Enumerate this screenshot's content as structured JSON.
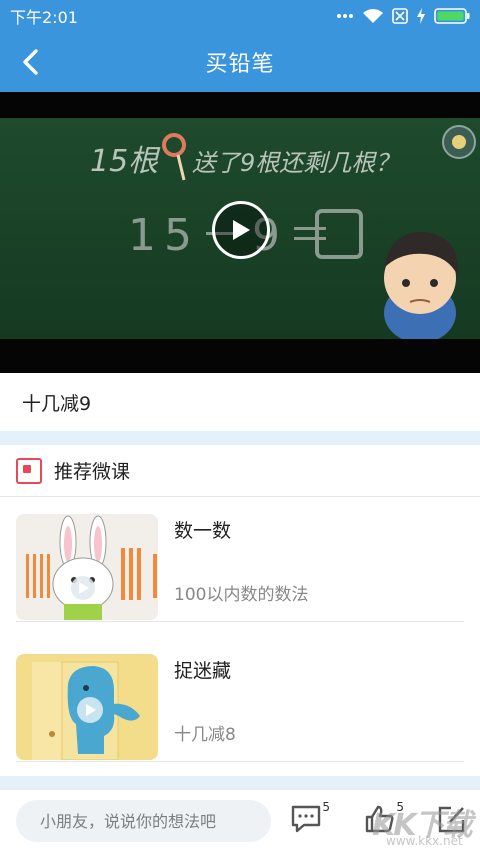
{
  "status_bar": {
    "time": "下午2:01",
    "icons": [
      "dots-icon",
      "wifi-icon",
      "sim-icon",
      "charging-icon",
      "battery-icon"
    ]
  },
  "header": {
    "title": "买铅笔",
    "back_icon": "chevron-left-icon"
  },
  "video": {
    "board_text_line1_a": "15根",
    "board_text_line1_b": "送了9根还剩几根？",
    "equation": "15－9＝",
    "play_icon": "play-icon"
  },
  "lesson": {
    "title": "十几减9"
  },
  "recommend": {
    "heading": "推荐微课",
    "courses": [
      {
        "name": "数一数",
        "desc": "100以内数的数法"
      },
      {
        "name": "捉迷藏",
        "desc": "十几减8"
      }
    ]
  },
  "bottom_bar": {
    "comment_placeholder": "小朋友，说说你的想法吧",
    "comment_count": "5",
    "like_count": "5"
  },
  "watermark": {
    "logo": "KK下载",
    "url": "www.kkx.net"
  },
  "colors": {
    "primary": "#3a95dc",
    "accent_red": "#e8485a",
    "separator": "#e4f1fb"
  }
}
